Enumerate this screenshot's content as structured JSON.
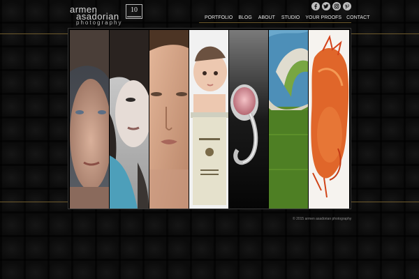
{
  "logo": {
    "line1": "armen",
    "line2": "asadorian",
    "line3": "photography",
    "badge": "10"
  },
  "social": [
    "facebook-icon",
    "twitter-icon",
    "instagram-icon",
    "pinterest-icon"
  ],
  "nav": {
    "items": [
      "PORTFOLIO",
      "BLOG",
      "ABOUT",
      "STUDIO",
      "YOUR PROOFS",
      "CONTACT"
    ]
  },
  "footer": {
    "text": "© 2015 armen asadorian photography"
  },
  "colors": {
    "accent": "#6e5a2c",
    "background": "#0b0b0b"
  }
}
